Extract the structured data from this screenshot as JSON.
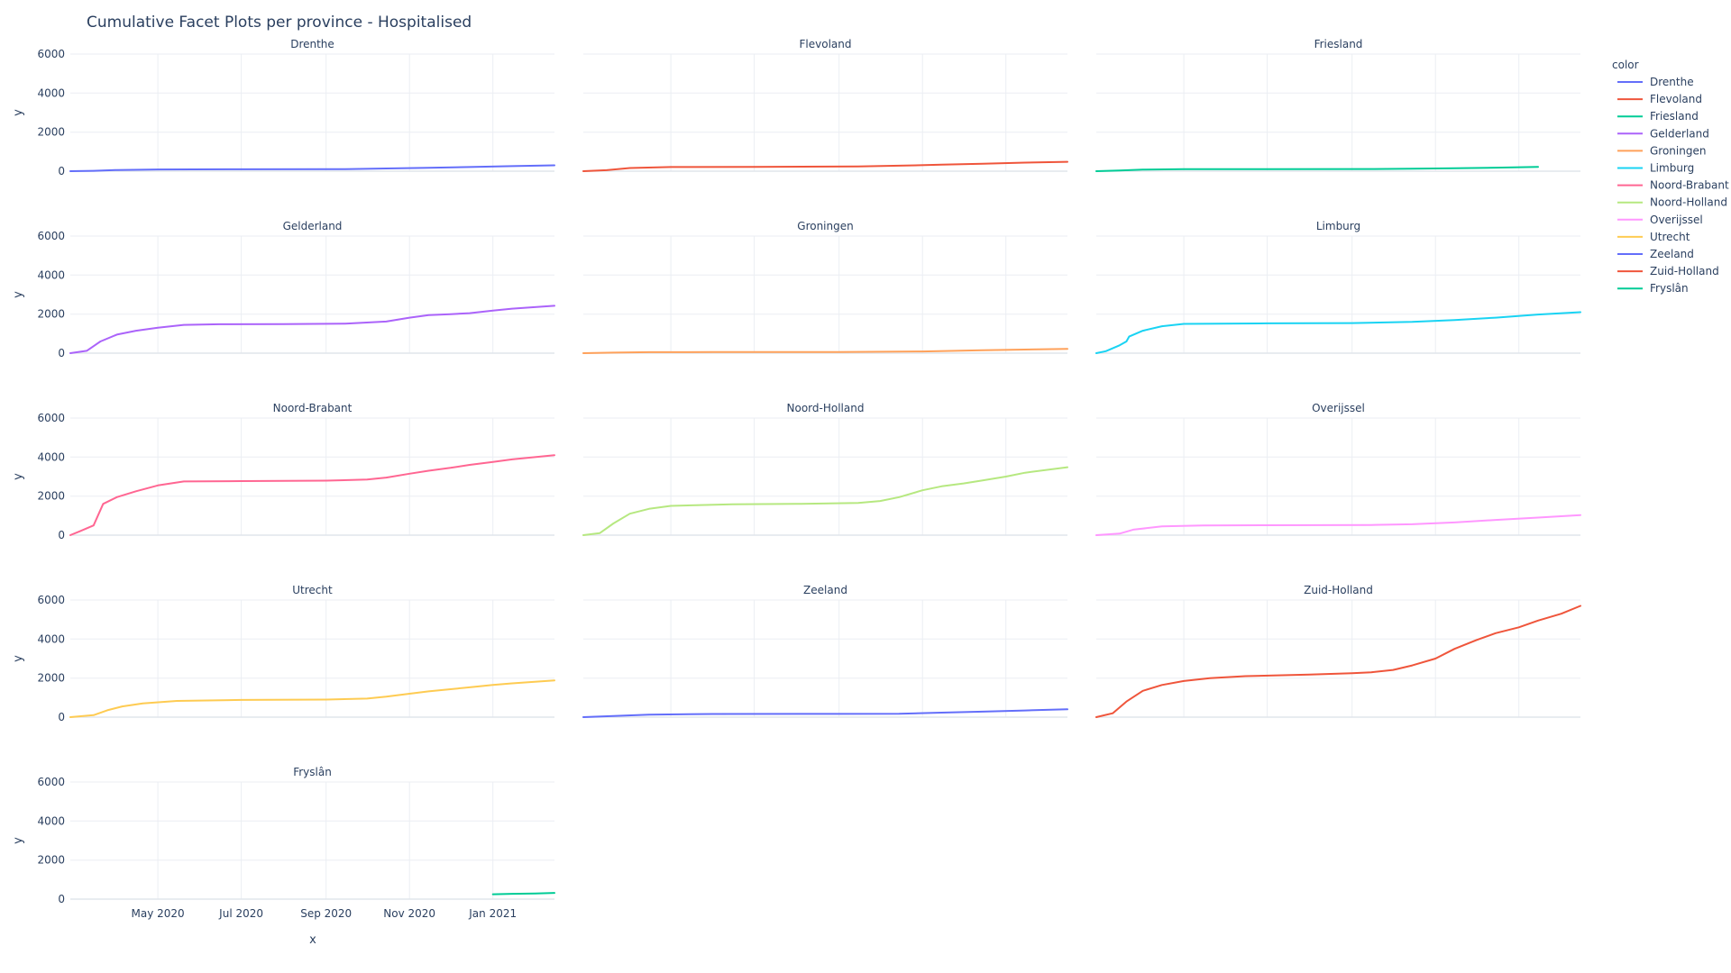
{
  "chart_data": {
    "type": "line",
    "title": "Cumulative Facet Plots per province - Hospitalised",
    "xlabel": "x",
    "ylabel": "y",
    "legend_title": "color",
    "legend_position": "right",
    "ylim": [
      0,
      6000
    ],
    "yticks": [
      0,
      2000,
      4000,
      6000
    ],
    "xlim": [
      "2020-02-27",
      "2021-02-15"
    ],
    "xticks": [
      {
        "date": "2020-05-01",
        "label": "May 2020"
      },
      {
        "date": "2020-07-01",
        "label": "Jul 2020"
      },
      {
        "date": "2020-09-01",
        "label": "Sep 2020"
      },
      {
        "date": "2020-11-01",
        "label": "Nov 2020"
      },
      {
        "date": "2021-01-01",
        "label": "Jan 2021"
      }
    ],
    "grid": true,
    "series": [
      {
        "name": "Drenthe",
        "color": "#636efa",
        "x": [
          "2020-02-27",
          "2020-03-15",
          "2020-04-01",
          "2020-05-01",
          "2020-07-01",
          "2020-09-15",
          "2020-10-15",
          "2020-11-15",
          "2020-12-15",
          "2021-01-15",
          "2021-02-15"
        ],
        "y": [
          0,
          20,
          60,
          90,
          95,
          100,
          140,
          170,
          210,
          260,
          300
        ]
      },
      {
        "name": "Flevoland",
        "color": "#ef553b",
        "x": [
          "2020-02-27",
          "2020-03-15",
          "2020-04-01",
          "2020-05-01",
          "2020-07-01",
          "2020-09-15",
          "2020-10-15",
          "2020-11-15",
          "2020-12-15",
          "2021-01-15",
          "2021-02-15"
        ],
        "y": [
          0,
          50,
          160,
          210,
          220,
          240,
          280,
          330,
          380,
          440,
          480
        ]
      },
      {
        "name": "Friesland",
        "color": "#00cc96",
        "x": [
          "2020-02-27",
          "2020-03-15",
          "2020-04-01",
          "2020-05-01",
          "2020-07-01",
          "2020-09-15",
          "2020-10-15",
          "2020-11-15",
          "2020-12-15",
          "2021-01-15"
        ],
        "y": [
          0,
          30,
          80,
          100,
          105,
          110,
          125,
          150,
          180,
          220
        ]
      },
      {
        "name": "Gelderland",
        "color": "#ab63fa",
        "x": [
          "2020-02-27",
          "2020-03-10",
          "2020-03-20",
          "2020-04-01",
          "2020-04-15",
          "2020-05-01",
          "2020-05-20",
          "2020-06-15",
          "2020-08-01",
          "2020-09-15",
          "2020-10-15",
          "2020-11-01",
          "2020-11-15",
          "2020-12-01",
          "2020-12-15",
          "2021-01-01",
          "2021-01-15",
          "2021-02-15"
        ],
        "y": [
          0,
          120,
          600,
          950,
          1150,
          1300,
          1450,
          1480,
          1490,
          1510,
          1620,
          1820,
          1950,
          2000,
          2050,
          2180,
          2280,
          2430
        ]
      },
      {
        "name": "Groningen",
        "color": "#ffa15a",
        "x": [
          "2020-02-27",
          "2020-03-20",
          "2020-04-15",
          "2020-06-01",
          "2020-09-01",
          "2020-11-01",
          "2020-12-15",
          "2021-02-15"
        ],
        "y": [
          0,
          30,
          50,
          55,
          60,
          90,
          150,
          220
        ]
      },
      {
        "name": "Limburg",
        "color": "#19d3f3",
        "x": [
          "2020-02-27",
          "2020-03-05",
          "2020-03-15",
          "2020-03-20",
          "2020-03-22",
          "2020-04-01",
          "2020-04-15",
          "2020-05-01",
          "2020-07-01",
          "2020-09-01",
          "2020-10-15",
          "2020-11-15",
          "2020-12-15",
          "2021-01-15",
          "2021-02-15"
        ],
        "y": [
          0,
          100,
          400,
          600,
          850,
          1150,
          1380,
          1500,
          1530,
          1540,
          1600,
          1700,
          1820,
          1980,
          2100
        ]
      },
      {
        "name": "Noord-Brabant",
        "color": "#ff6692",
        "x": [
          "2020-02-27",
          "2020-03-05",
          "2020-03-15",
          "2020-03-22",
          "2020-04-01",
          "2020-04-15",
          "2020-05-01",
          "2020-05-20",
          "2020-07-01",
          "2020-09-01",
          "2020-10-01",
          "2020-10-15",
          "2020-11-01",
          "2020-11-15",
          "2020-12-01",
          "2020-12-15",
          "2021-01-01",
          "2021-01-15",
          "2021-02-15"
        ],
        "y": [
          0,
          200,
          500,
          1600,
          1950,
          2250,
          2550,
          2750,
          2770,
          2790,
          2850,
          2950,
          3150,
          3300,
          3450,
          3600,
          3750,
          3880,
          4100
        ]
      },
      {
        "name": "Noord-Holland",
        "color": "#b6e880",
        "x": [
          "2020-02-27",
          "2020-03-10",
          "2020-03-20",
          "2020-04-01",
          "2020-04-15",
          "2020-05-01",
          "2020-06-15",
          "2020-08-01",
          "2020-09-15",
          "2020-10-01",
          "2020-10-15",
          "2020-11-01",
          "2020-11-15",
          "2020-12-01",
          "2020-12-15",
          "2021-01-01",
          "2021-01-15",
          "2021-02-15"
        ],
        "y": [
          0,
          100,
          600,
          1100,
          1350,
          1500,
          1580,
          1600,
          1650,
          1750,
          1950,
          2300,
          2500,
          2650,
          2800,
          3000,
          3200,
          3480
        ]
      },
      {
        "name": "Overijssel",
        "color": "#ff97ff",
        "x": [
          "2020-02-27",
          "2020-03-15",
          "2020-03-25",
          "2020-04-15",
          "2020-05-15",
          "2020-07-01",
          "2020-09-15",
          "2020-10-15",
          "2020-11-15",
          "2020-12-15",
          "2021-01-15",
          "2021-02-15"
        ],
        "y": [
          0,
          80,
          280,
          450,
          500,
          510,
          520,
          560,
          650,
          780,
          900,
          1030
        ]
      },
      {
        "name": "Utrecht",
        "color": "#fecb52",
        "x": [
          "2020-02-27",
          "2020-03-15",
          "2020-03-25",
          "2020-04-05",
          "2020-04-20",
          "2020-05-15",
          "2020-07-01",
          "2020-09-01",
          "2020-10-01",
          "2020-10-15",
          "2020-11-01",
          "2020-11-15",
          "2020-12-01",
          "2020-12-15",
          "2021-01-01",
          "2021-01-15",
          "2021-02-15"
        ],
        "y": [
          0,
          100,
          350,
          550,
          700,
          830,
          880,
          900,
          950,
          1050,
          1200,
          1320,
          1430,
          1530,
          1650,
          1730,
          1880
        ]
      },
      {
        "name": "Zeeland",
        "color": "#636efa",
        "x": [
          "2020-02-27",
          "2020-03-20",
          "2020-04-15",
          "2020-06-01",
          "2020-09-01",
          "2020-10-15",
          "2020-11-15",
          "2020-12-15",
          "2021-01-15",
          "2021-02-15"
        ],
        "y": [
          0,
          60,
          130,
          160,
          165,
          175,
          230,
          280,
          340,
          400
        ]
      },
      {
        "name": "Zuid-Holland",
        "color": "#ef553b",
        "x": [
          "2020-02-27",
          "2020-03-10",
          "2020-03-20",
          "2020-04-01",
          "2020-04-15",
          "2020-05-01",
          "2020-05-20",
          "2020-06-15",
          "2020-08-01",
          "2020-09-01",
          "2020-09-15",
          "2020-10-01",
          "2020-10-15",
          "2020-11-01",
          "2020-11-15",
          "2020-12-01",
          "2020-12-15",
          "2021-01-01",
          "2021-01-15",
          "2021-02-01",
          "2021-02-15"
        ],
        "y": [
          0,
          200,
          800,
          1350,
          1650,
          1850,
          2000,
          2100,
          2180,
          2250,
          2300,
          2420,
          2650,
          3000,
          3500,
          3950,
          4300,
          4600,
          4950,
          5300,
          5700
        ]
      },
      {
        "name": "Fryslân",
        "color": "#00cc96",
        "x": [
          "2021-01-01",
          "2021-01-15",
          "2021-02-01",
          "2021-02-15"
        ],
        "y": [
          250,
          270,
          290,
          320
        ]
      }
    ]
  }
}
